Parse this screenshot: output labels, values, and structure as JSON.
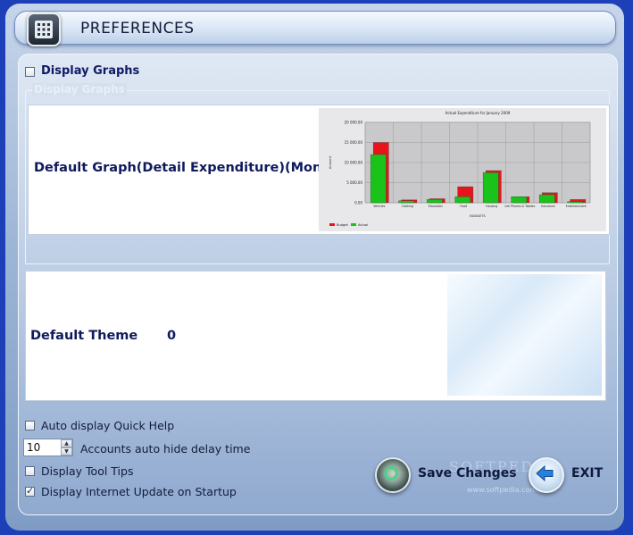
{
  "header": {
    "title": "PREFERENCES",
    "icon": "app-grid-icon"
  },
  "graphs": {
    "toggle_label": "Display Graphs",
    "toggle_checked": false,
    "group_title": "Display Graphs",
    "default_graph_label": "Default Graph(Detail Expenditure)(Month)"
  },
  "theme": {
    "label": "Default Theme",
    "value": "0"
  },
  "options": {
    "auto_help_label": "Auto display Quick Help",
    "auto_help_checked": false,
    "hide_delay_value": "10",
    "hide_delay_label": "Accounts auto hide delay time",
    "tooltips_label": "Display Tool Tips",
    "tooltips_checked": false,
    "internet_update_label": "Display Internet Update on Startup",
    "internet_update_checked": true
  },
  "buttons": {
    "save_label": "Save Changes",
    "exit_label": "EXIT"
  },
  "watermark": {
    "brand": "SOFTPEDIA",
    "url": "www.softpedia.com"
  },
  "chart_data": {
    "type": "bar",
    "title": "Actual Expenditure for January 2009",
    "xlabel": "BUDGETS",
    "ylabel": "Amount",
    "ylim": [
      0,
      20000
    ],
    "yticks": [
      "20 000.00",
      "15 000.00",
      "10 000.00",
      "5 000.00",
      "0.00"
    ],
    "categories": [
      "Vehicles",
      "Clothing",
      "Education",
      "Food",
      "Housing",
      "Cell Phones & Tablets",
      "Insurance",
      "Entertainment"
    ],
    "series": [
      {
        "name": "Budget",
        "color": "#e8141b",
        "values": [
          15000,
          700,
          1000,
          4000,
          8000,
          1500,
          2500,
          800
        ]
      },
      {
        "name": "Actual",
        "color": "#19c31a",
        "values": [
          12000,
          500,
          800,
          1500,
          7500,
          1500,
          2000,
          300
        ]
      }
    ],
    "legend": "bottom-left",
    "grid": true
  }
}
